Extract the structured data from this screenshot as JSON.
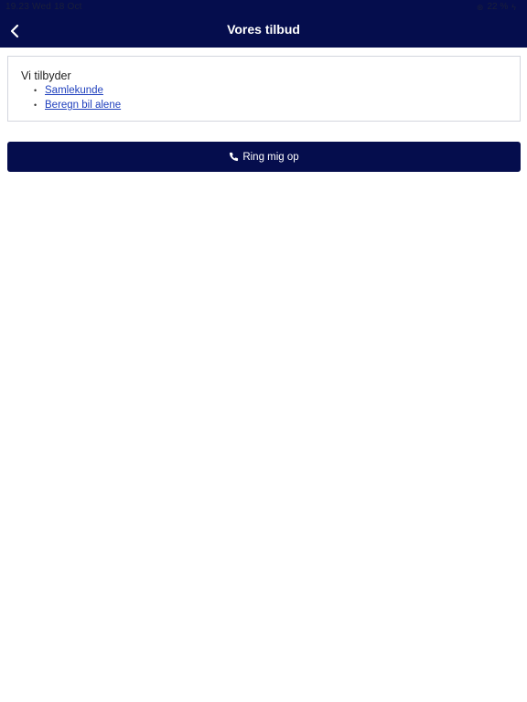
{
  "status_bar": {
    "time": "19.23",
    "date": "Wed 18 Oct",
    "battery": "22 %"
  },
  "header": {
    "title": "Vores tilbud",
    "back_icon": "chevron-left-icon"
  },
  "offers": {
    "heading": "Vi tilbyder",
    "items": [
      {
        "label": "Samlekunde"
      },
      {
        "label": "Beregn bil alene"
      }
    ]
  },
  "call_button": {
    "label": "Ring mig op",
    "icon": "phone-icon"
  },
  "colors": {
    "brand": "#050d4d",
    "link": "#1e3fbd",
    "card_border": "#d3d6de"
  }
}
